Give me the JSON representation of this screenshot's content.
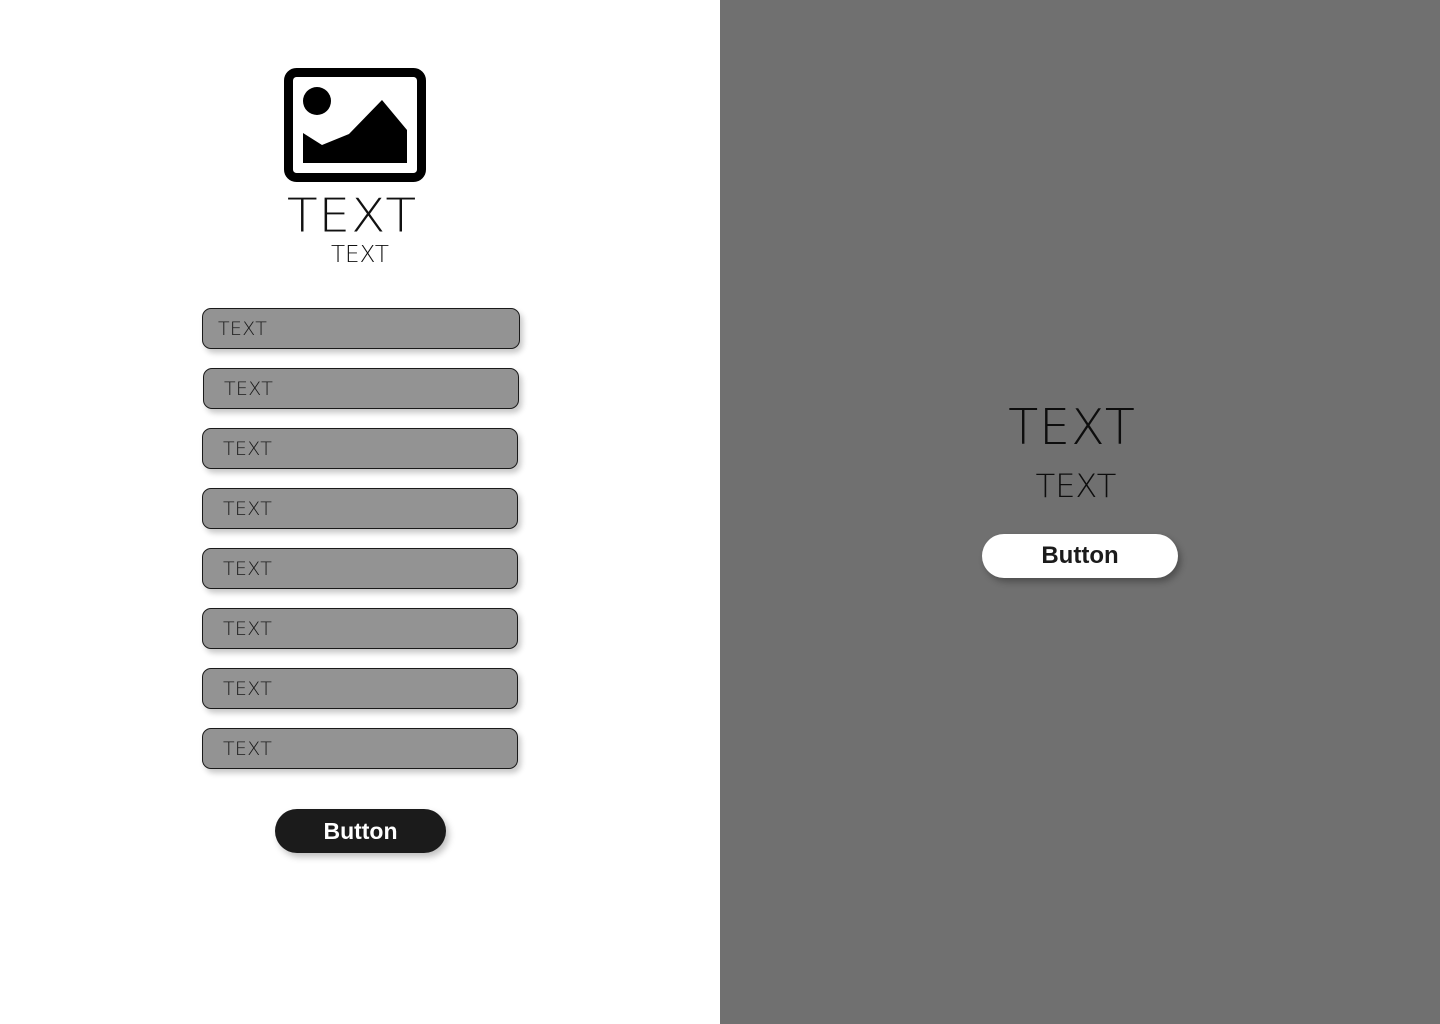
{
  "left": {
    "icon": "image-icon",
    "title": "TEXT",
    "subtitle": "TEXT",
    "fields": [
      {
        "label": "TEXT"
      },
      {
        "label": "TEXT"
      },
      {
        "label": "TEXT"
      },
      {
        "label": "TEXT"
      },
      {
        "label": "TEXT"
      },
      {
        "label": "TEXT"
      },
      {
        "label": "TEXT"
      },
      {
        "label": "TEXT"
      }
    ],
    "button_label": "Button"
  },
  "right": {
    "title": "TEXT",
    "subtitle": "TEXT",
    "button_label": "Button"
  },
  "colors": {
    "left_background": "#ffffff",
    "right_background": "#707070",
    "field_fill": "#939393",
    "dark_button": "#1b1b1b",
    "light_button": "#ffffff"
  }
}
